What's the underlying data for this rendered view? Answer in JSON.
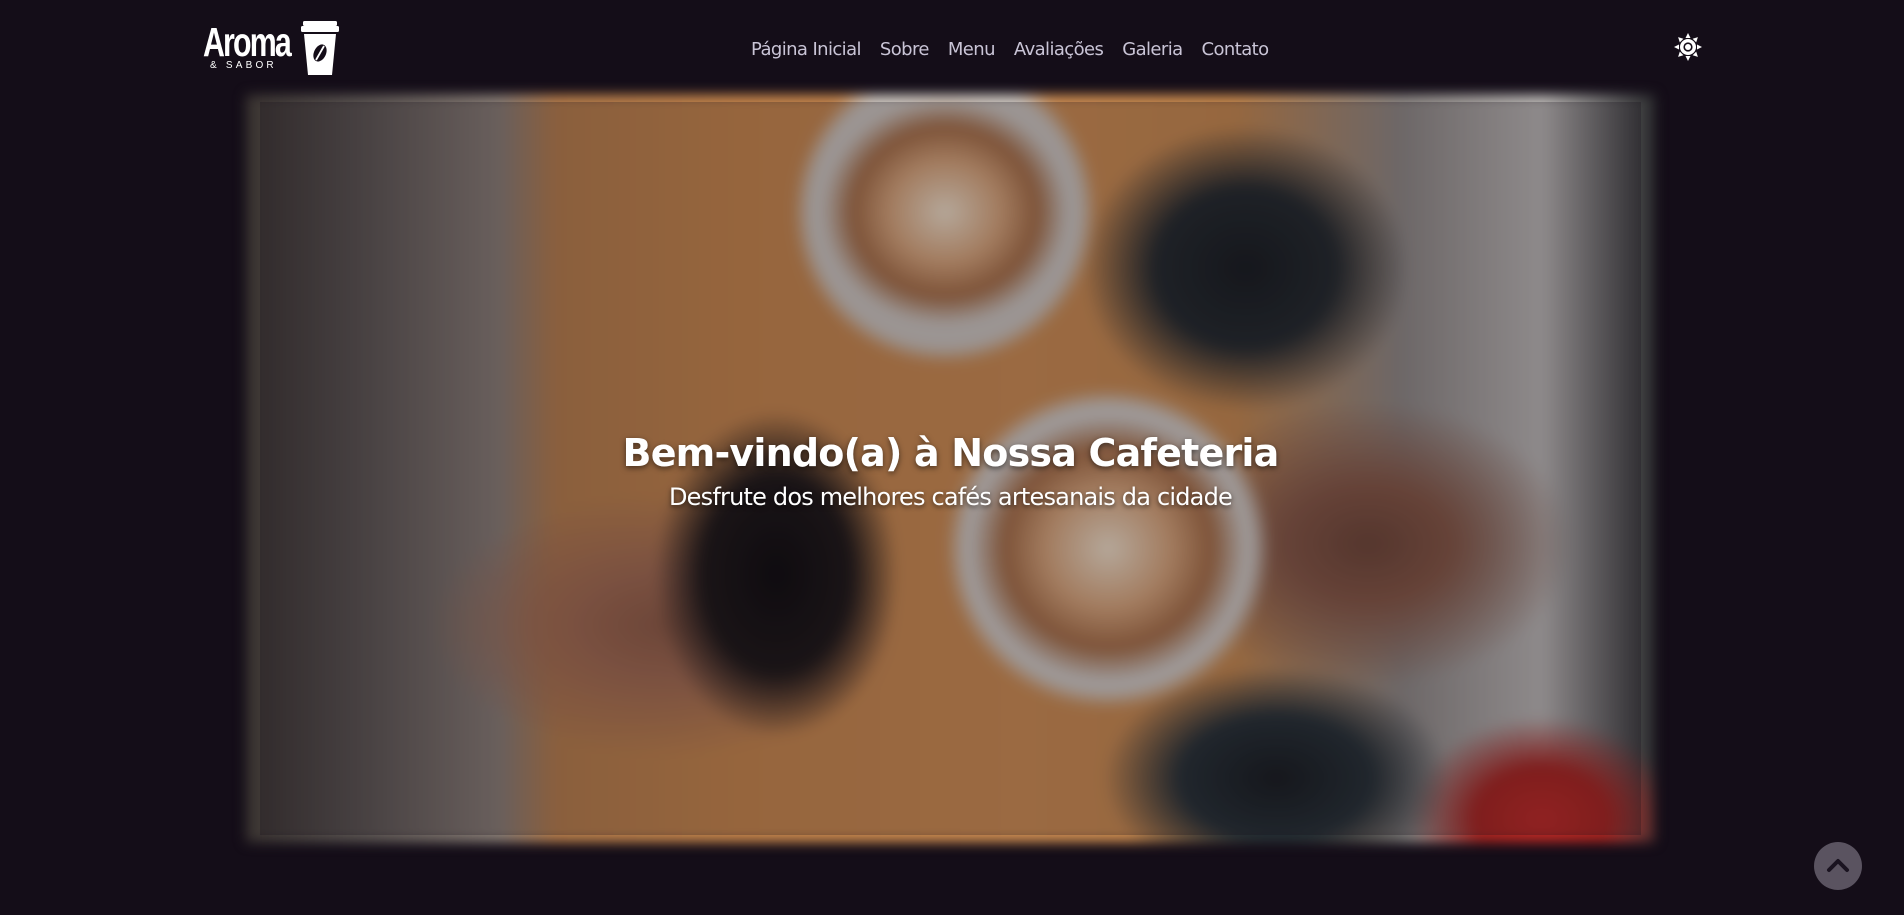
{
  "header": {
    "logo": {
      "name": "Aroma",
      "tagline": "& SABOR",
      "icon": "coffee-cup-icon"
    },
    "nav": {
      "items": [
        {
          "label": "Página Inicial"
        },
        {
          "label": "Sobre"
        },
        {
          "label": "Menu"
        },
        {
          "label": "Avaliações"
        },
        {
          "label": "Galeria"
        },
        {
          "label": "Contato"
        }
      ]
    },
    "theme_toggle": {
      "icon": "sun-icon"
    }
  },
  "hero": {
    "title": "Bem-vindo(a) à Nossa Cafeteria",
    "subtitle": "Desfrute dos melhores cafés artesanais da cidade",
    "image": "coffee-cups-toast-photo"
  },
  "back_to_top": {
    "icon": "chevron-up-icon"
  },
  "colors": {
    "background": "#140d18",
    "nav_text": "#c9c4d6",
    "text": "#ffffff",
    "back_to_top_bg": "#5a5360"
  }
}
